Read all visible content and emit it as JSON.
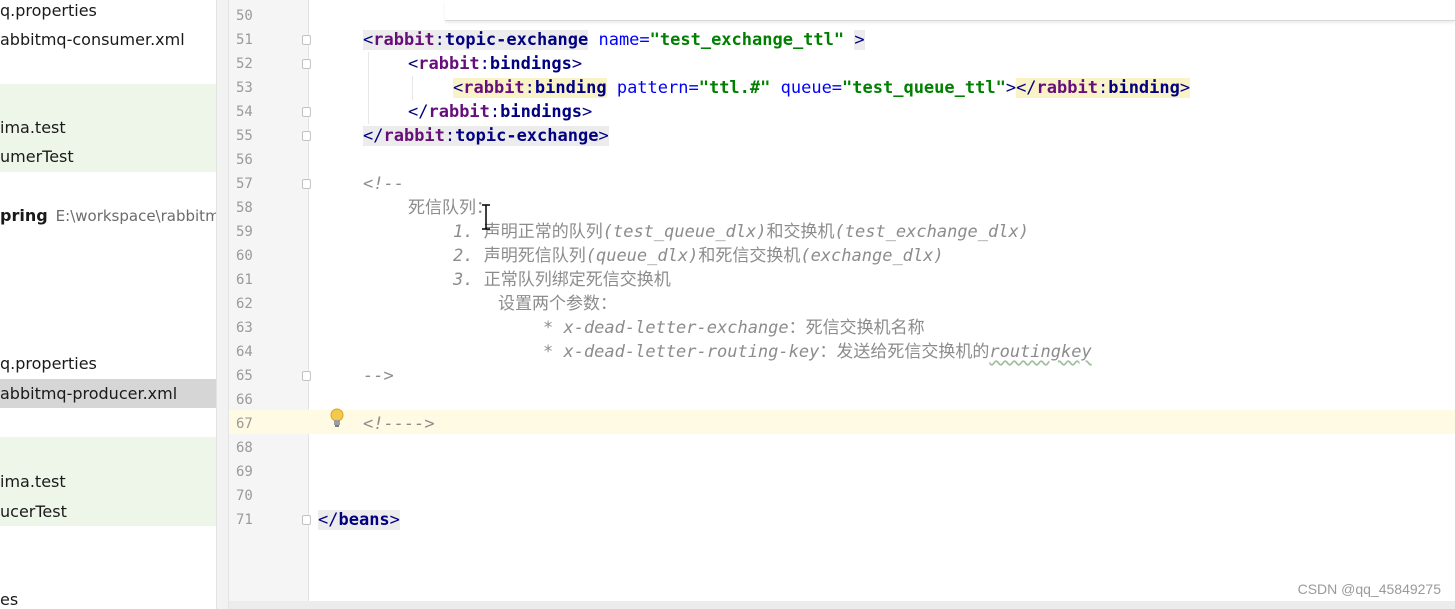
{
  "sidebar": {
    "items": [
      {
        "label": "q.properties"
      },
      {
        "label": "abbitmq-consumer.xml"
      },
      {
        "label": "ima.test"
      },
      {
        "label": "umerTest"
      },
      {
        "label": "pring",
        "path": "E:\\workspace\\rabbitm"
      },
      {
        "label": "q.properties"
      },
      {
        "label": "abbitmq-producer.xml"
      },
      {
        "label": "ima.test"
      },
      {
        "label": "ucerTest"
      },
      {
        "label": "es"
      }
    ]
  },
  "editor": {
    "line_numbers": [
      "50",
      "51",
      "52",
      "53",
      "54",
      "55",
      "56",
      "57",
      "58",
      "59",
      "60",
      "61",
      "62",
      "63",
      "64",
      "65",
      "66",
      "67",
      "68",
      "69",
      "70",
      "71"
    ],
    "exchange_name": "\"test_exchange_ttl\"",
    "binding_pattern": "\"ttl.#\"",
    "binding_queue": "\"test_queue_ttl\"",
    "comment_open": "<!--",
    "comment_title": "死信队列：",
    "step1_num": "1.",
    "step1_a": "声明正常的队列",
    "step1_b": "(test_queue_dlx)",
    "step1_c": "和交换机",
    "step1_d": "(test_exchange_dlx)",
    "step2_num": "2.",
    "step2_a": "声明死信队列",
    "step2_b": "(queue_dlx)",
    "step2_c": "和死信交换机",
    "step2_d": "(exchange_dlx)",
    "step3_num": "3.",
    "step3_a": "正常队列绑定死信交换机",
    "params_title": "设置两个参数：",
    "param1_key": "* x-dead-letter-exchange",
    "param1_desc": "：死信交换机名称",
    "param2_key": "* x-dead-letter-routing-key",
    "param2_desc": "：发送给死信交换机的",
    "param2_tail": "routingkey",
    "comment_close": "-->",
    "empty_comment": "<!---->"
  },
  "watermark": "CSDN @qq_45849275"
}
